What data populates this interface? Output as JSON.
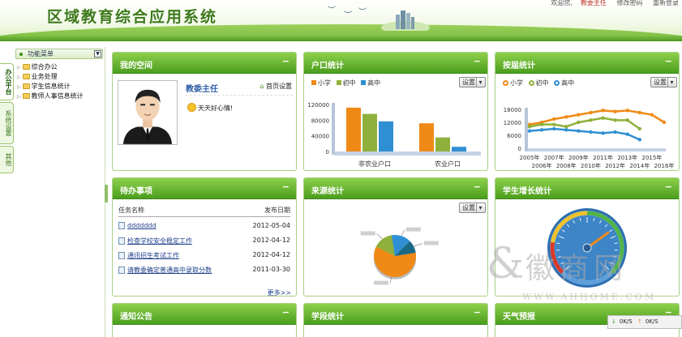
{
  "header": {
    "title": "区域教育综合应用系统",
    "user_prefix": "欢迎您,",
    "user": "教委主任",
    "links": [
      "修改密码",
      "重新登录"
    ]
  },
  "left_tabs": [
    "办公平台",
    "系统设置",
    "其他"
  ],
  "menu": {
    "title": "功能菜单",
    "items": [
      "综合办公",
      "业务处理",
      "学生信息统计",
      "教师人事信息统计"
    ]
  },
  "panels": {
    "my_space": {
      "title": "我的空间",
      "name": "教委主任",
      "home_settings": "首页设置",
      "mood": "天天好心情!"
    },
    "household": {
      "title": "户口统计",
      "settings": "设置",
      "legend": [
        "小学",
        "初中",
        "高中"
      ]
    },
    "graduation": {
      "title": "按届统计",
      "settings": "设置",
      "legend": [
        "小学",
        "初中",
        "高中"
      ]
    },
    "todo": {
      "title": "待办事项",
      "col_name": "任务名称",
      "col_date": "发布日期",
      "rows": [
        {
          "name": "ddddddd",
          "date": "2012-05-04"
        },
        {
          "name": "检查学校安全稳定工作",
          "date": "2012-04-12"
        },
        {
          "name": "通讯招生考试工作",
          "date": "2012-04-12"
        },
        {
          "name": "请教委确定普通高中录取分数",
          "date": "2011-03-30"
        }
      ],
      "more": "更多>>"
    },
    "source": {
      "title": "来源统计",
      "settings": "设置"
    },
    "growth": {
      "title": "学生增长统计",
      "gauge_value": 70
    },
    "notice": {
      "title": "通知公告"
    },
    "stage": {
      "title": "学段统计"
    },
    "weather": {
      "title": "天气预报"
    }
  },
  "tray": {
    "down": "0K/S",
    "up": "0K/S"
  },
  "watermark": {
    "text": "徽商网",
    "url": "WWW.AHHOME.COM"
  },
  "colors": {
    "primary": "#ef8a17",
    "middle": "#8fb13c",
    "high": "#2f8fd3",
    "header_green": "#4b9e1d"
  },
  "chart_data": [
    {
      "type": "bar",
      "title": "户口统计",
      "categories": [
        "非农业户口",
        "农业户口"
      ],
      "series": [
        {
          "name": "小学",
          "values": [
            112000,
            72000
          ]
        },
        {
          "name": "初中",
          "values": [
            96000,
            36000
          ]
        },
        {
          "name": "高中",
          "values": [
            77000,
            12000
          ]
        }
      ],
      "yticks": [
        "120000",
        "80000",
        "40000",
        "0"
      ],
      "ylim": [
        0,
        120000
      ]
    },
    {
      "type": "line",
      "title": "按届统计",
      "x": [
        2005,
        2006,
        2007,
        2008,
        2009,
        2010,
        2011,
        2012,
        2013,
        2014,
        2015,
        2016
      ],
      "xticks_top": [
        "2005年",
        "2007年",
        "2009年",
        "2011年",
        "2013年",
        "2015年"
      ],
      "xticks_bottom": [
        "2006年",
        "2008年",
        "2010年",
        "2012年",
        "2014年",
        "2016年"
      ],
      "series": [
        {
          "name": "小学",
          "values": [
            11000,
            12000,
            13500,
            14500,
            15500,
            16500,
            17500,
            17000,
            17500,
            16500,
            15500,
            12000
          ]
        },
        {
          "name": "初中",
          "values": [
            10000,
            11000,
            11000,
            10000,
            12000,
            13000,
            14000,
            13000,
            13000,
            9000
          ]
        },
        {
          "name": "高中",
          "values": [
            8000,
            8500,
            9000,
            8500,
            8000,
            7500,
            7000,
            7500,
            6500,
            4000
          ]
        }
      ],
      "yticks": [
        "18000",
        "12000",
        "6000",
        "0"
      ],
      "ylim": [
        0,
        18000
      ]
    },
    {
      "type": "pie",
      "title": "来源统计",
      "values": [
        60,
        15,
        15,
        10
      ]
    }
  ]
}
